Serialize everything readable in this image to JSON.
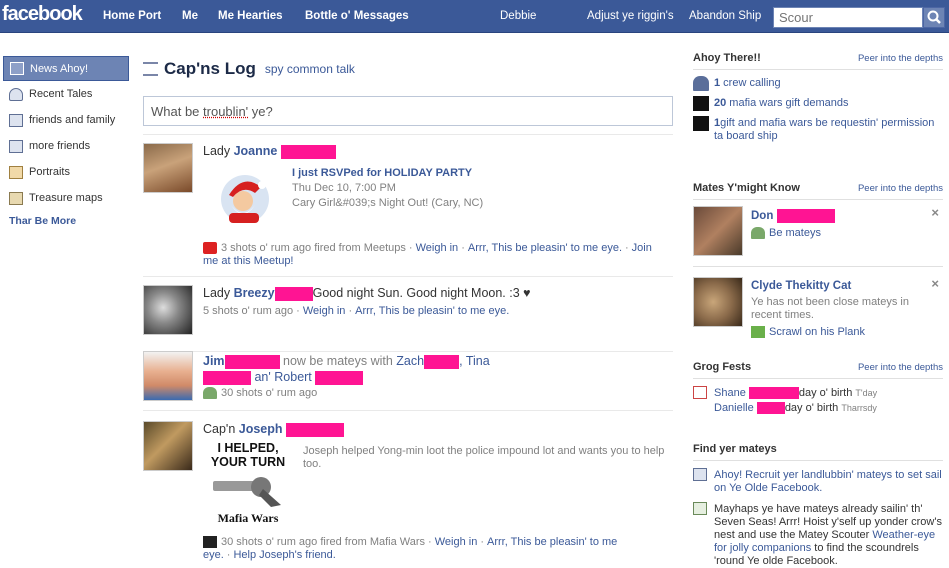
{
  "topbar": {
    "logo": "facebook",
    "nav": [
      "Home Port",
      "Me",
      "Me Hearties",
      "Bottle o' Messages"
    ],
    "user": "Debbie",
    "settings": "Adjust ye riggin's",
    "logout": "Abandon Ship",
    "search_placeholder": "Scour"
  },
  "leftnav": {
    "items": [
      "News Ahoy!",
      "Recent Tales",
      "friends and family",
      "more friends",
      "Portraits",
      "Treasure maps"
    ],
    "more": "Thar Be More"
  },
  "feed": {
    "title": "Cap'ns Log",
    "filter": "spy common talk",
    "status_prefix": "What be ",
    "status_word": "troublin'",
    "status_suffix": " ye?",
    "stories": [
      {
        "prefix": "Lady ",
        "actor": "Joanne",
        "event_title": "I just RSVPed for HOLIDAY PARTY",
        "event_date": "Thu Dec 10, 7:00 PM",
        "event_place": "Cary Girl&#039;s Night Out! (Cary, NC)",
        "time": "3 shots o' rum ago fired from Meetups",
        "links": [
          "Weigh in",
          "Arrr, This be pleasin' to me eye.",
          "Join me at this Meetup!"
        ]
      },
      {
        "prefix": "Lady ",
        "actor": "Breezy",
        "text": "Good night Sun. Good night Moon. :3 ♥",
        "time": "5 shots o' rum ago",
        "links": [
          "Weigh in",
          "Arrr, This be pleasin' to me eye."
        ]
      },
      {
        "actor": "Jim",
        "text": "now be mateys with",
        "friend1": "Zach",
        "comma": ",",
        "friend2": "Tina",
        "conj": "an'",
        "friend3": "Robert",
        "time": "30 shots o' rum ago"
      },
      {
        "prefix": "Cap'n ",
        "actor": "Joseph",
        "image_text1": "I HELPED,",
        "image_text2": "YOUR TURN",
        "image_text3": "Mafia Wars",
        "text": "Joseph helped Yong-min loot the police impound lot and wants you to help too.",
        "time": "30 shots o' rum ago fired from Mafia Wars",
        "links": [
          "Weigh in",
          "Arrr, This be pleasin' to me eye.",
          "Help Joseph's friend."
        ]
      }
    ]
  },
  "right": {
    "requests": {
      "title": "Ahoy There!!",
      "link": "Peer into the depths",
      "items": [
        {
          "count": "1",
          "text": " crew calling"
        },
        {
          "count": "20",
          "text": " mafia wars gift demands"
        },
        {
          "count": "1",
          "text": "gift and mafia wars be requestin' permission ta board ship"
        }
      ]
    },
    "suggestions": {
      "title": "Mates Y'might Know",
      "link": "Peer into the depths",
      "p1_name": "Don",
      "p1_action": "Be mateys",
      "p2_name": "Clyde Thekitty Cat",
      "p2_text": "Ye has not been close mateys in recent times.",
      "p2_action": "Scrawl on his Plank"
    },
    "birthdays": {
      "title": "Grog Fests",
      "link": "Peer into the depths",
      "b1_name": "Shane",
      "b1_text": "day o' birth",
      "b1_day": "T'day",
      "b2_name": "Danielle",
      "b2_text": "day o' birth",
      "b2_day": "Tharrsdy"
    },
    "find": {
      "title": "Find yer mateys",
      "item1": "Ahoy! Recruit yer landlubbin' mateys to set sail on Ye Olde Facebook.",
      "item2_pre": "Mayhaps ye have mateys already sailin' th' Seven Seas! Arrr! Hoist y'self up yonder crow's nest and use the Matey Scouter ",
      "item2_link": "Weather-eye for jolly companions",
      "item2_post": " to find the scoundrels 'round Ye olde Facebook."
    }
  }
}
